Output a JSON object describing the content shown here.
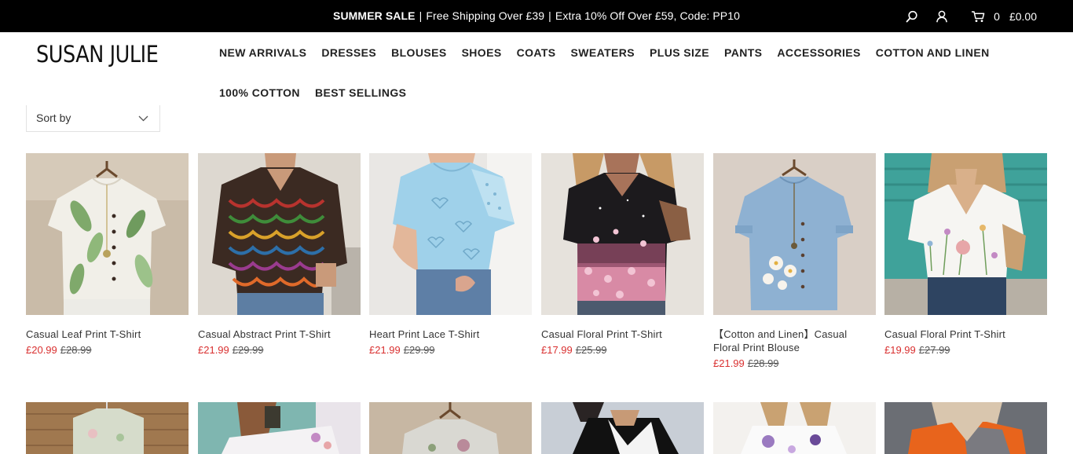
{
  "announcement": {
    "sale": "SUMMER SALE",
    "sep": "|",
    "shipping": "Free Shipping Over £39",
    "extra": "Extra 10% Off Over £59, Code: PP10"
  },
  "utility": {
    "cart_count": "0",
    "cart_total": "£0.00"
  },
  "brand": {
    "logo": "SUSAN JULIE"
  },
  "nav": {
    "row1": [
      "NEW ARRIVALS",
      "DRESSES",
      "BLOUSES",
      "SHOES",
      "COATS",
      "SWEATERS",
      "PLUS SIZE",
      "PANTS",
      "ACCESSORIES",
      "COTTON AND LINEN"
    ],
    "row2": [
      "100% COTTON",
      "BEST SELLINGS"
    ]
  },
  "sort": {
    "label": "Sort by"
  },
  "products": [
    {
      "name": "Casual Leaf Print T-Shirt",
      "price": "£20.99",
      "old_price": "£28.99"
    },
    {
      "name": "Casual Abstract Print T-Shirt",
      "price": "£21.99",
      "old_price": "£29.99"
    },
    {
      "name": "Heart Print Lace T-Shirt",
      "price": "£21.99",
      "old_price": "£29.99"
    },
    {
      "name": "Casual Floral Print T-Shirt",
      "price": "£17.99",
      "old_price": "£25.99"
    },
    {
      "name": "【Cotton and Linen】Casual Floral Print Blouse",
      "price": "£21.99",
      "old_price": "£28.99"
    },
    {
      "name": "Casual Floral Print T-Shirt",
      "price": "£19.99",
      "old_price": "£27.99"
    }
  ],
  "colors": {
    "accent_sale": "#d93030",
    "topbar": "#000000"
  }
}
